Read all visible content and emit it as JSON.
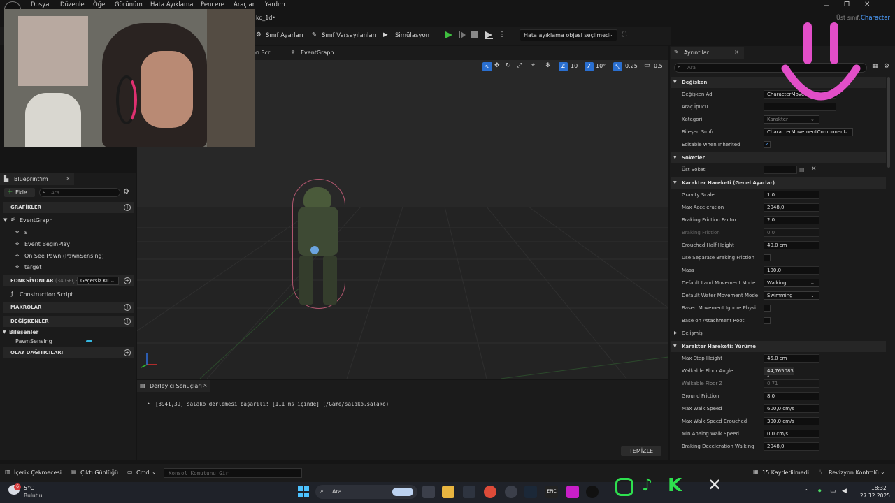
{
  "menu": [
    "Dosya",
    "Düzenle",
    "Öğe",
    "Görünüm",
    "Hata Ayıklama",
    "Pencere",
    "Araçlar",
    "Yardım"
  ],
  "tab_title": "ko_1d•",
  "parent_class": {
    "label": "Üst sınıf:",
    "value": "Character"
  },
  "toolbar": {
    "class_settings": "Sınıf Ayarları",
    "class_defaults": "Sınıf Varsayılanları",
    "simulation": "Simülasyon",
    "debug_dropdown": "Hata ayıklama objesi seçilmedi"
  },
  "editor_tabs": [
    "on Scr...",
    "EventGraph"
  ],
  "viewport": {
    "grid": "10",
    "angle": "10°",
    "scale": "0,25",
    "camera": "0,5"
  },
  "blueprint_panel": {
    "title": "Blueprint'im",
    "add_label": "Ekle",
    "search_placeholder": "Ara",
    "graphs_header": "GRAFİKLER",
    "graph_items": [
      "EventGraph",
      "s",
      "Event BeginPlay",
      "On See Pawn (PawnSensing)",
      "target"
    ],
    "functions_header": "FONKSİYONLAR",
    "functions_note": "(34 GEÇERSİZ",
    "functions_filter": "Geçersiz Kıl",
    "function_items": [
      "Construction Script"
    ],
    "macros_header": "MAKROLAR",
    "variables_header": "DEĞİŞKENLER",
    "components_label": "Bileşenler",
    "component_items": [
      "PawnSensing"
    ],
    "dispatchers_header": "OLAY DAĞITICILARI"
  },
  "details": {
    "tab": "Ayrıntılar",
    "search_placeholder": "Ara",
    "sections": {
      "variable": "Değişken",
      "sockets": "Soketler",
      "general": "Karakter Hareketi (Genel Ayarlar)",
      "advanced": "Gelişmiş",
      "walking": "Karakter Hareketi: Yürüme"
    },
    "variable_rows": [
      {
        "label": "Değişken Adı",
        "value": "CharacterMovement"
      },
      {
        "label": "Araç İpucu",
        "value": ""
      },
      {
        "label": "Kategori",
        "value": "Karakter"
      },
      {
        "label": "Bileşen Sınıfı",
        "value": "CharacterMovementComponent"
      },
      {
        "label": "Editable when Inherited",
        "value": "✓"
      }
    ],
    "socket_rows": [
      {
        "label": "Üst Soket",
        "value": ""
      }
    ],
    "general_rows": [
      {
        "label": "Gravity Scale",
        "value": "1,0"
      },
      {
        "label": "Max Acceleration",
        "value": "2048,0"
      },
      {
        "label": "Braking Friction Factor",
        "value": "2,0"
      },
      {
        "label": "Braking Friction",
        "value": "0,0"
      },
      {
        "label": "Crouched Half Height",
        "value": "40,0 cm"
      },
      {
        "label": "Use Separate Braking Friction",
        "value": ""
      },
      {
        "label": "Mass",
        "value": "100,0"
      },
      {
        "label": "Default Land Movement Mode",
        "value": "Walking"
      },
      {
        "label": "Default Water Movement Mode",
        "value": "Swimming"
      },
      {
        "label": "Based Movement Ignore Physi...",
        "value": ""
      },
      {
        "label": "Base on Attachment Root",
        "value": ""
      }
    ],
    "walking_rows": [
      {
        "label": "Max Step Height",
        "value": "45,0 cm"
      },
      {
        "label": "Walkable Floor Angle",
        "value": "44,765083 °"
      },
      {
        "label": "Walkable Floor Z",
        "value": "0,71"
      },
      {
        "label": "Ground Friction",
        "value": "8,0"
      },
      {
        "label": "Max Walk Speed",
        "value": "600,0 cm/s"
      },
      {
        "label": "Max Walk Speed Crouched",
        "value": "300,0 cm/s"
      },
      {
        "label": "Min Analog Walk Speed",
        "value": "0,0 cm/s"
      },
      {
        "label": "Braking Deceleration Walking",
        "value": "2048,0"
      }
    ]
  },
  "compiler": {
    "tab": "Derleyici Sonuçları",
    "message": "[3941,39] salako derlemesi başarılı! [111 ms içinde] (/Game/salako.salako)",
    "clear": "TEMİZLE"
  },
  "statusbar": {
    "content_drawer": "İçerik Çekmecesi",
    "output_log": "Çıktı Günlüğü",
    "cmd": "Cmd",
    "console_placeholder": "Konsol Komutunu Gir",
    "saved": "15 Kaydedilmedi",
    "revision": "Revizyon Kontrolü"
  },
  "taskbar": {
    "weather_temp": "5°C",
    "weather_desc": "Bulutlu",
    "weather_badge": "6",
    "search": "Ara",
    "time": "18:32",
    "date": "27.12.2025"
  },
  "colors": {
    "accent": "#e24ec8",
    "play": "#3fbf3f",
    "check": "#59a6ff"
  }
}
